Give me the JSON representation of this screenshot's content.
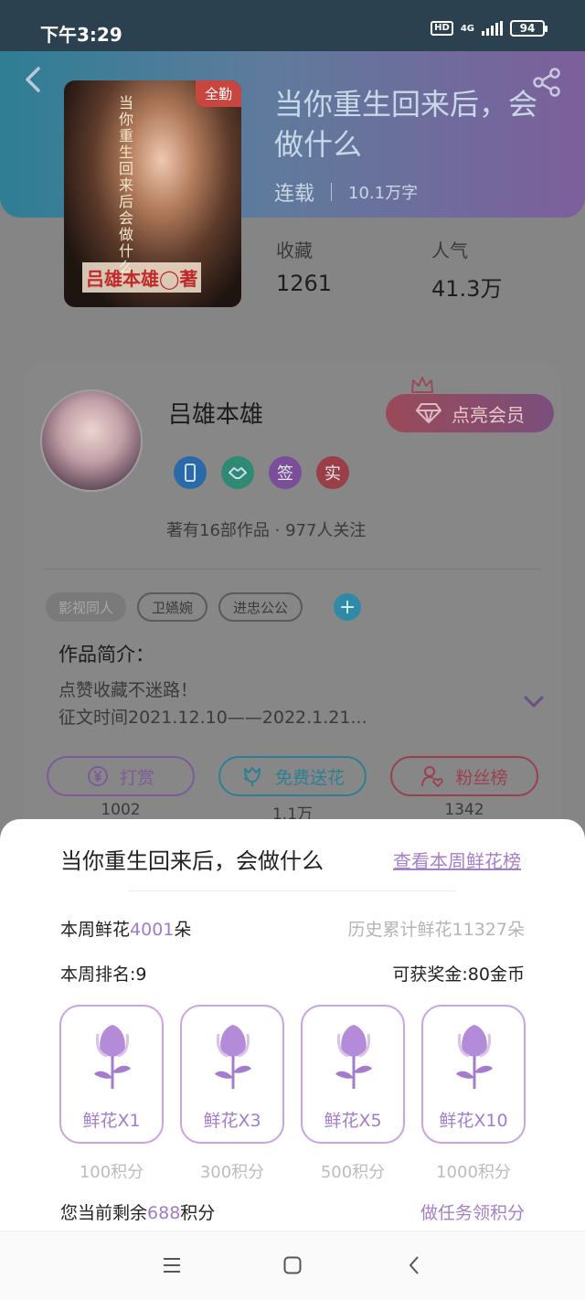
{
  "status_bar": {
    "time": "下午3:29",
    "hd": "HD",
    "net": "4G",
    "battery": "94"
  },
  "book": {
    "badge": "全勤",
    "title": "当你重生回来后，会做什么",
    "status": "连载",
    "word_count": "10.1万字",
    "cover_vertical_text": "当你重生回来后会做什么",
    "cover_author": "吕雄本雄◯著"
  },
  "stats": {
    "favorites_label": "收藏",
    "favorites_value": "1261",
    "popularity_label": "人气",
    "popularity_value": "41.3万"
  },
  "author": {
    "name": "吕雄本雄",
    "vip_label": "点亮会员",
    "badges": [
      {
        "icon": "phone-badge-icon",
        "color": "#2a6aa8"
      },
      {
        "icon": "handshake-badge-icon",
        "color": "#2e8a72"
      },
      {
        "text": "签",
        "color": "#7a4e98"
      },
      {
        "text": "实",
        "color": "#9a3e48"
      }
    ],
    "works_line": "著有16部作品 · 977人关注"
  },
  "tags": [
    "影视同人",
    "卫嬿婉",
    "进忠公公"
  ],
  "intro": {
    "label": "作品简介：",
    "line1": "点赞收藏不迷路！",
    "line2": "征文时间2021.12.10——2022.1.21..."
  },
  "actions": [
    {
      "label": "打赏",
      "count": "1002",
      "color": "#7d5a99"
    },
    {
      "label": "免费送花",
      "count": "1.1万",
      "color": "#2d7f94"
    },
    {
      "label": "粉丝榜",
      "count": "1342",
      "color": "#9a4050"
    }
  ],
  "flower_sheet": {
    "title": "当你重生回来后，会做什么",
    "rank_link": "查看本周鲜花榜",
    "week_prefix": "本周鲜花",
    "week_count": "4001",
    "week_suffix": "朵",
    "history": "历史累计鲜花11327朵",
    "rank": "本周排名:9",
    "prize": "可获奖金:80金币",
    "options": [
      {
        "label": "鲜花X1",
        "points": "100积分"
      },
      {
        "label": "鲜花X3",
        "points": "300积分"
      },
      {
        "label": "鲜花X5",
        "points": "500积分"
      },
      {
        "label": "鲜花X10",
        "points": "1000积分"
      }
    ],
    "remain_prefix": "您当前剩余",
    "remain_points": "688",
    "remain_suffix": "积分",
    "task_link": "做任务领积分",
    "accent_color": "#a580c9"
  }
}
